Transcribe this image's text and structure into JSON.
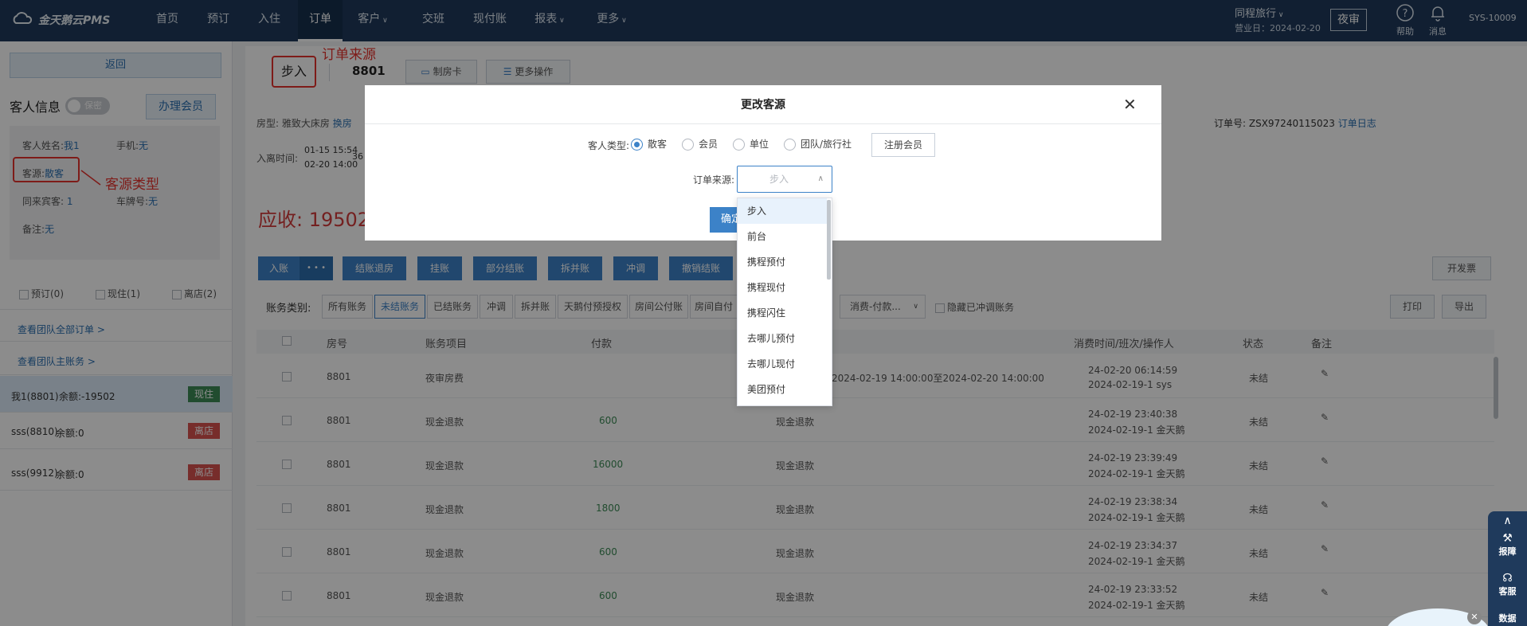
{
  "app": {
    "name": "金天鹅云PMS"
  },
  "nav": {
    "items": [
      "首页",
      "预订",
      "入住",
      "订单",
      "客户",
      "交班",
      "现付账",
      "报表",
      "更多"
    ],
    "active": "订单"
  },
  "header": {
    "hotel": "同程旅行",
    "business_day": "营业日：2024-02-20",
    "audit": "夜审",
    "help": "帮助",
    "messages": "消息",
    "user": "SYS-10009"
  },
  "left": {
    "back": "返回",
    "guest_info": "客人信息",
    "private_toggle": "保密",
    "member_btn": "办理会员",
    "name_label": "客人姓名:",
    "name_value": "我1",
    "phone_label": "手机:",
    "phone_value": "无",
    "source_label": "客源:",
    "source_value": "散客",
    "companions_label": "同来宾客:",
    "companions_value": "1",
    "plate_label": "车牌号:",
    "plate_value": "无",
    "remark_label": "备注:",
    "remark_value": "无",
    "filters": [
      "预订(0)",
      "现住(1)",
      "离店(2)"
    ],
    "link_orders": "查看团队全部订单 >",
    "link_master": "查看团队主账务 >",
    "rooms": [
      {
        "name": "我1(8801)",
        "balance": "余额:-19502",
        "status": "现住",
        "color": "#3d8b57"
      },
      {
        "name": "sss(8810)",
        "balance": "余额:0",
        "status": "离店",
        "color": "#d9534f"
      },
      {
        "name": "sss(9912)",
        "balance": "余额:0",
        "status": "离店",
        "color": "#d9534f"
      }
    ]
  },
  "annotations": {
    "order_source": "订单来源",
    "source_type": "客源类型"
  },
  "order": {
    "source": "步入",
    "room": "8801",
    "room_card": "制房卡",
    "more_ops": "更多操作",
    "room_type": "房型: 雅致大床房",
    "change_room": "换房",
    "checkin_label": "入离时间:",
    "checkin": "01-15 15:54",
    "checkout": "02-20 14:00",
    "nights": "36",
    "order_no": "订单号: ZSX97240115023",
    "order_log": "订单日志",
    "receivable": "应收: 19502"
  },
  "toolbar": {
    "buttons": [
      "入账",
      "结账退房",
      "挂账",
      "部分结账",
      "拆并账",
      "冲调",
      "撤销结账"
    ],
    "more": "• • •",
    "invoice": "开发票",
    "print": "打印",
    "export": "导出"
  },
  "filters": {
    "label": "账务类别:",
    "tabs": [
      "所有账务",
      "未结账务",
      "已结账务",
      "冲调",
      "拆并账",
      "天鹅付预授权",
      "房间公付账",
      "房间自付"
    ],
    "active": "未结账务",
    "consume_select": "消费-付款...",
    "hide_reversed": "隐藏已冲调账务"
  },
  "table": {
    "headers": [
      "房号",
      "账务项目",
      "付款",
      "消费时间/班次/操作人",
      "状态",
      "备注"
    ],
    "rows": [
      {
        "room": "8801",
        "item": "夜审房费",
        "pay": "",
        "desc": "2024-02-19 14:00:00至2024-02-20 14:00:00",
        "time": "24-02-20 06:14:59",
        "shift": "2024-02-19-1 sys",
        "status": "未结"
      },
      {
        "room": "8801",
        "item": "现金退款",
        "pay": "600",
        "desc": "现金退款",
        "time": "24-02-19 23:40:38",
        "shift": "2024-02-19-1 金天鹅",
        "status": "未结"
      },
      {
        "room": "8801",
        "item": "现金退款",
        "pay": "16000",
        "desc": "现金退款",
        "time": "24-02-19 23:39:49",
        "shift": "2024-02-19-1 金天鹅",
        "status": "未结"
      },
      {
        "room": "8801",
        "item": "现金退款",
        "pay": "1800",
        "desc": "现金退款",
        "time": "24-02-19 23:38:34",
        "shift": "2024-02-19-1 金天鹅",
        "status": "未结"
      },
      {
        "room": "8801",
        "item": "现金退款",
        "pay": "600",
        "desc": "现金退款",
        "time": "24-02-19 23:34:37",
        "shift": "2024-02-19-1 金天鹅",
        "status": "未结"
      },
      {
        "room": "8801",
        "item": "现金退款",
        "pay": "600",
        "desc": "现金退款",
        "time": "24-02-19 23:33:52",
        "shift": "2024-02-19-1 金天鹅",
        "status": "未结"
      }
    ]
  },
  "modal": {
    "title": "更改客源",
    "guest_type_label": "客人类型:",
    "types": [
      "散客",
      "会员",
      "单位",
      "团队/旅行社"
    ],
    "selected_type": "散客",
    "register_btn": "注册会员",
    "source_label": "订单来源:",
    "source_placeholder": "步入",
    "confirm": "确定"
  },
  "dropdown": {
    "options": [
      "步入",
      "前台",
      "携程预付",
      "携程现付",
      "携程闪住",
      "去哪儿预付",
      "去哪儿现付",
      "美团预付"
    ],
    "selected": "步入"
  },
  "side_widget": {
    "items": [
      "报障",
      "客服",
      "数据"
    ]
  }
}
